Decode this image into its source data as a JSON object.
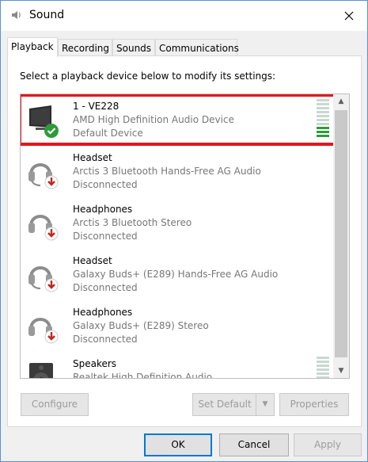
{
  "window": {
    "title": "Sound"
  },
  "tabs": [
    {
      "label": "Playback",
      "active": true
    },
    {
      "label": "Recording",
      "active": false
    },
    {
      "label": "Sounds",
      "active": false
    },
    {
      "label": "Communications",
      "active": false
    }
  ],
  "instruction": "Select a playback device below to modify its settings:",
  "devices": [
    {
      "name": "1 - VE228",
      "description": "AMD High Definition Audio Device",
      "status": "Default Device",
      "icon": "monitor-icon",
      "badge": "default-check-icon",
      "level_bars_on": 3,
      "selected": true
    },
    {
      "name": "Headset",
      "description": "Arctis 3 Bluetooth Hands-Free AG Audio",
      "status": "Disconnected",
      "icon": "headset-icon",
      "badge": "disconnected-arrow-icon"
    },
    {
      "name": "Headphones",
      "description": "Arctis 3 Bluetooth Stereo",
      "status": "Disconnected",
      "icon": "headphones-icon",
      "badge": "disconnected-arrow-icon"
    },
    {
      "name": "Headset",
      "description": "Galaxy Buds+ (E289) Hands-Free AG Audio",
      "status": "Disconnected",
      "icon": "headset-icon",
      "badge": "disconnected-arrow-icon"
    },
    {
      "name": "Headphones",
      "description": "Galaxy Buds+ (E289) Stereo",
      "status": "Disconnected",
      "icon": "headphones-icon",
      "badge": "disconnected-arrow-icon"
    },
    {
      "name": "Speakers",
      "description": "Realtek High Definition Audio",
      "status": "",
      "icon": "speaker-icon",
      "badge": ""
    }
  ],
  "buttons": {
    "configure": "Configure",
    "set_default": "Set Default",
    "properties": "Properties",
    "ok": "OK",
    "cancel": "Cancel",
    "apply": "Apply"
  },
  "colors": {
    "selection_border": "#e3181b",
    "level_on": "#2f9a3a",
    "accent": "#0078d7"
  }
}
